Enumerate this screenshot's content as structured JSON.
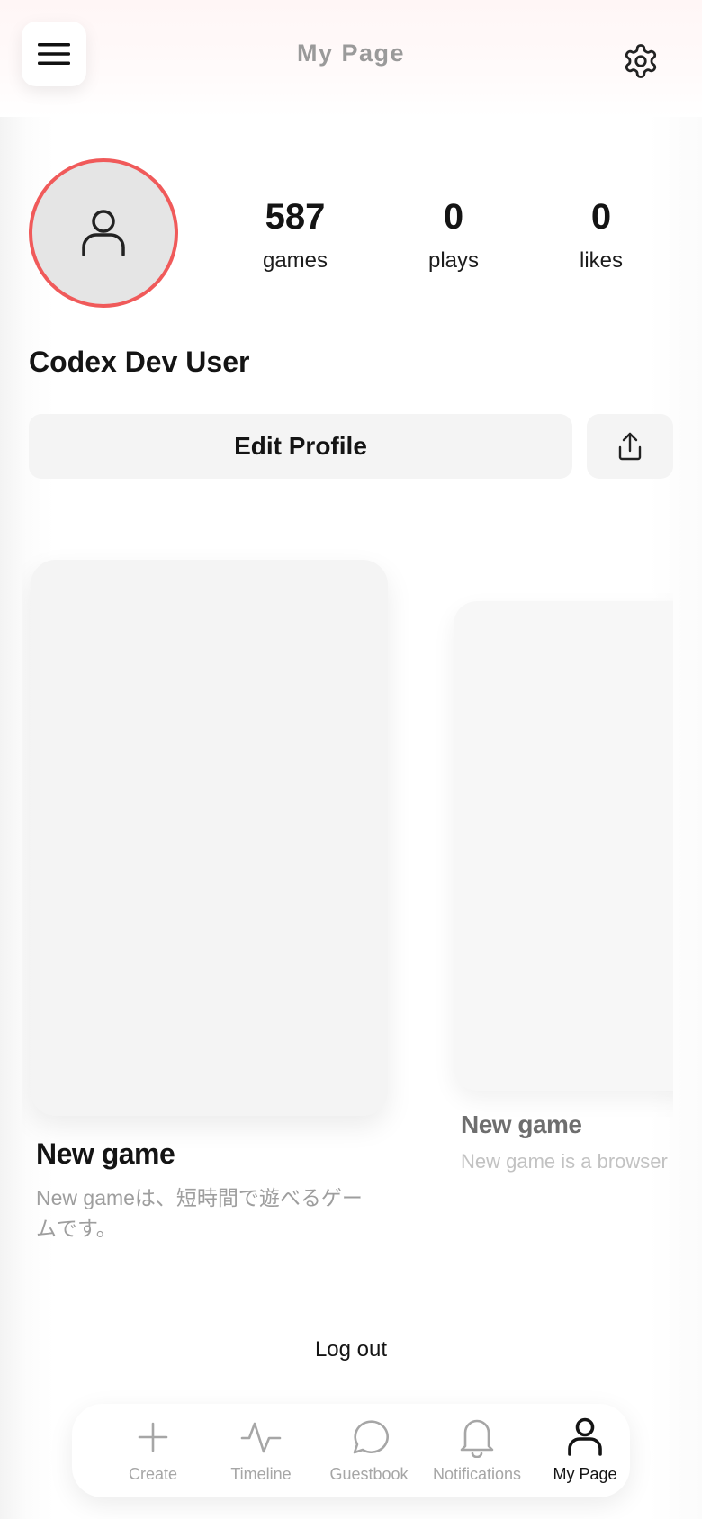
{
  "header": {
    "title": "My Page",
    "menu_icon": "hamburger-menu-icon",
    "settings_icon": "gear-icon"
  },
  "profile": {
    "avatar_icon": "user-icon",
    "avatar_ring_color": "#f05a5a",
    "name": "Codex Dev User",
    "stats": [
      {
        "value": "587",
        "label": "games"
      },
      {
        "value": "0",
        "label": "plays"
      },
      {
        "value": "0",
        "label": "likes"
      }
    ],
    "edit_label": "Edit Profile",
    "share_icon": "share-icon"
  },
  "games": [
    {
      "title": "New game",
      "description": "New gameは、短時間で遊べるゲームです。"
    },
    {
      "title": "New game",
      "description": "New game is a browser"
    }
  ],
  "logout_label": "Log out",
  "nav": {
    "items": [
      {
        "label": "Create",
        "icon": "plus-icon",
        "active": false
      },
      {
        "label": "Timeline",
        "icon": "activity-icon",
        "active": false
      },
      {
        "label": "Guestbook",
        "icon": "chat-bubble-icon",
        "active": false
      },
      {
        "label": "Notifications",
        "icon": "bell-icon",
        "active": false
      },
      {
        "label": "My Page",
        "icon": "user-icon",
        "active": true
      }
    ]
  }
}
